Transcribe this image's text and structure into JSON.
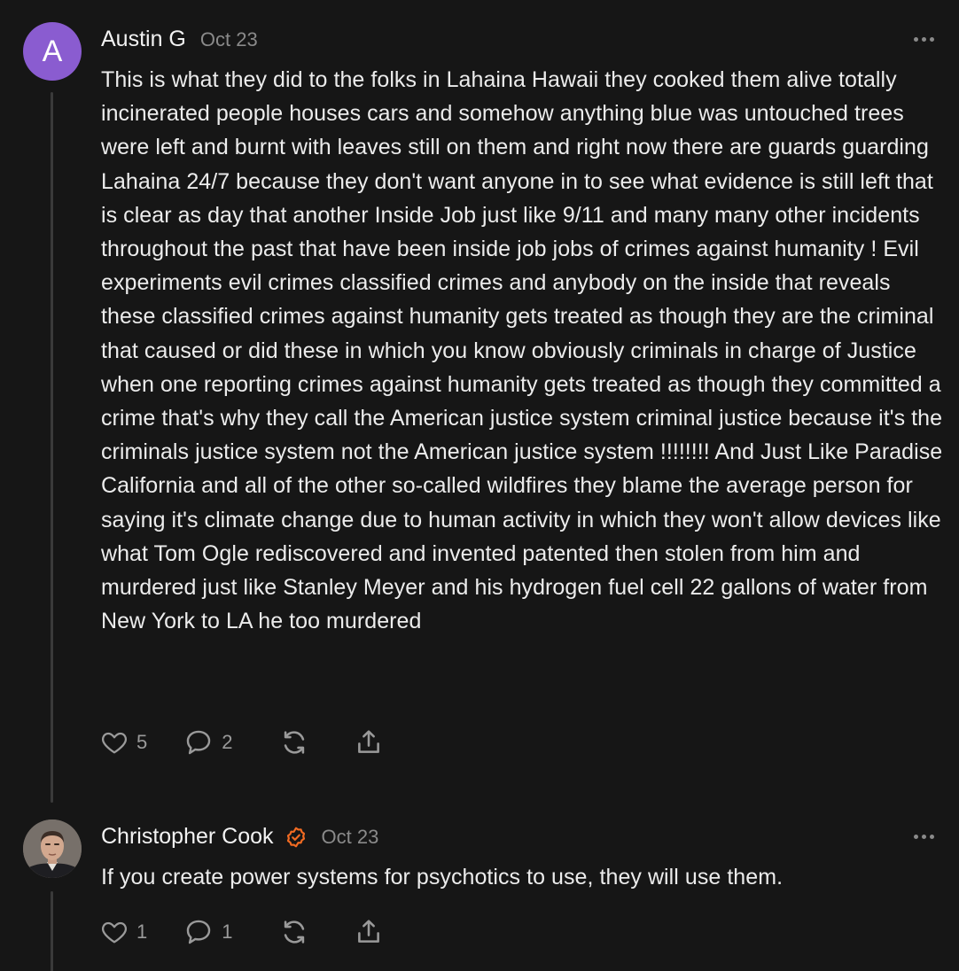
{
  "comments": [
    {
      "avatar_letter": "A",
      "avatar_color": "#8a5cd0",
      "author": "Austin G",
      "date": "Oct 23",
      "body": "This is what they did to the folks in Lahaina Hawaii they cooked them alive totally incinerated people houses cars and somehow anything blue was untouched trees were left and burnt with leaves still on them and right now there are guards guarding Lahaina 24/7 because they don't want anyone in to see what evidence is still left that is clear as day that another Inside Job just like 9/11 and many many other incidents throughout the past that have been inside job jobs of crimes against humanity ! Evil experiments evil crimes classified crimes and anybody on the inside that reveals these classified crimes against humanity gets treated as though they are the criminal that caused or did these in which you know obviously criminals in charge of Justice when one reporting crimes against humanity gets treated as though they committed a crime that's why they call the American justice system criminal justice because it's the criminals justice system not the American justice system !!!!!!!! And Just Like Paradise California and all of the other so-called wildfires they blame the average person for saying it's climate change due to human activity in which they won't allow devices like what Tom Ogle rediscovered and invented patented then stolen from him and murdered just like Stanley Meyer and his hydrogen fuel cell 22 gallons of water from New York to LA he too murdered",
      "likes": "5",
      "replies": "2"
    },
    {
      "author": "Christopher Cook",
      "verified": true,
      "verified_color": "#f26b22",
      "date": "Oct 23",
      "body": "If you create power systems for psychotics to use, they will use them.",
      "likes": "1",
      "replies": "1"
    }
  ],
  "icons": {
    "like": "heart-icon",
    "reply": "speech-bubble-icon",
    "restack": "restack-icon",
    "share": "share-icon",
    "more": "more-dots-icon"
  },
  "colors": {
    "background": "#161616",
    "text": "#ececec",
    "muted": "#8a8a8a"
  }
}
